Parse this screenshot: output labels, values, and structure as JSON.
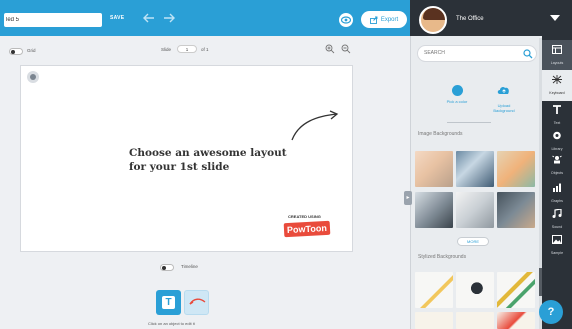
{
  "toolbar": {
    "title_value": "led 5",
    "save_label": "SAVE",
    "export_label": "Export"
  },
  "workspace": {
    "grid_label": "Grid",
    "slide_label": "Slide",
    "slide_number": "1",
    "slide_of": "of 1",
    "headline_line1": "Choose an awesome layout",
    "headline_line2": "for your 1st slide",
    "logo_top": "CREATED USING",
    "logo_main": "PowToon",
    "timeline_label": "Timeline",
    "hint": "Click on an object to edit it"
  },
  "panel": {
    "user_name": "The Office",
    "search_placeholder": "SEARCH",
    "pick_color_label": "Pick a color",
    "upload_label_line1": "Upload",
    "upload_label_line2": "Background",
    "image_backgrounds_label": "Image Backgrounds",
    "more_label": "MORE",
    "stylized_backgrounds_label": "Stylized Backgrounds"
  },
  "rail": {
    "items": [
      {
        "label": "Layouts",
        "icon": "layouts-icon"
      },
      {
        "label": "Keyboard",
        "icon": "background-pattern-icon"
      },
      {
        "label": "Text",
        "icon": "text-icon"
      },
      {
        "label": "Library",
        "icon": "library-icon"
      },
      {
        "label": "Objects",
        "icon": "objects-icon"
      },
      {
        "label": "Graphs",
        "icon": "graphs-icon"
      },
      {
        "label": "Sound",
        "icon": "sound-icon"
      },
      {
        "label": "Sample",
        "icon": "sample-icon"
      }
    ]
  },
  "help_label": "?",
  "colors": {
    "accent": "#2a9fd6",
    "dark": "#2b3138",
    "logo_red": "#e94b3c"
  }
}
